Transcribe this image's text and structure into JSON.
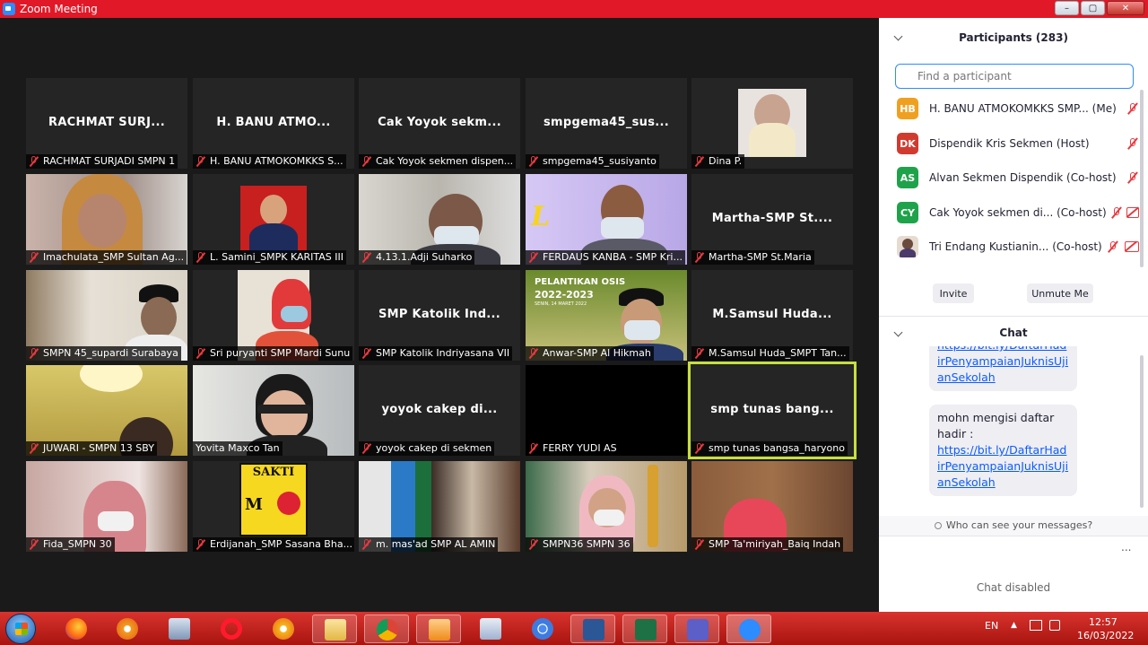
{
  "window": {
    "title": "Zoom Meeting",
    "controls": [
      "–",
      "▢",
      "✕"
    ]
  },
  "colors": {
    "title_bar": "#e11827",
    "taskbar": "#c4221d",
    "active_speaker_border": "#c7df3e",
    "muted_icon": "#e6393f",
    "link": "#0b5cff"
  },
  "tiles": [
    {
      "display": "RACHMAT  SURJ...",
      "label": "RACHMAT SURJADI SMPN 1"
    },
    {
      "display": "H. BANU  ATMO...",
      "label": "H. BANU ATMOKOMKKS S..."
    },
    {
      "display": "Cak  Yoyok  sekm...",
      "label": "Cak Yoyok sekmen dispen..."
    },
    {
      "display": "smpgema45_sus...",
      "label": "smpgema45_susiyanto"
    },
    {
      "display": "",
      "label": "Dina P."
    },
    {
      "display": "",
      "label": "Imachulata_SMP Sultan Ag..."
    },
    {
      "display": "",
      "label": "L. Samini_SMPK KARITAS III"
    },
    {
      "display": "",
      "label": "4.13.1.Adji Suharko"
    },
    {
      "display": "",
      "label": "FERDAUS KANBA - SMP Kri..."
    },
    {
      "display": "Martha-SMP  St....",
      "label": "Martha-SMP St.Maria"
    },
    {
      "display": "",
      "label": "SMPN 45_supardi Surabaya"
    },
    {
      "display": "",
      "label": "Sri puryanti SMP Mardi Sunu"
    },
    {
      "display": "SMP  Katolik  Ind...",
      "label": "SMP Katolik Indriyasana VII"
    },
    {
      "display": "",
      "label": "Anwar-SMP Al Hikmah",
      "poster_title": "PELANTIKAN OSIS",
      "poster_year": "2022-2023",
      "poster_date": "SENIN, 14 MARET 2022"
    },
    {
      "display": "M.Samsul  Huda...",
      "label": "M.Samsul Huda_SMPT Tan..."
    },
    {
      "display": "",
      "label": "JUWARI - SMPN 13 SBY"
    },
    {
      "display": "",
      "label": "Yovita Maxco Tan"
    },
    {
      "display": "yoyok  cakep  di...",
      "label": "yoyok cakep di sekmen"
    },
    {
      "display": "",
      "label": "FERRY YUDI AS"
    },
    {
      "display": "smp  tunas  bang...",
      "label": "smp tunas bangsa_haryono",
      "active": true
    },
    {
      "display": "",
      "label": "Fida_SMPN 30"
    },
    {
      "display": "",
      "label": "Erdijanah_SMP Sasana Bha...",
      "sign_top": "SAKTI",
      "sign_mid": "M"
    },
    {
      "display": "",
      "label": "m. mas'ad SMP AL AMIN"
    },
    {
      "display": "",
      "label": "SMPN36 SMPN 36"
    },
    {
      "display": "",
      "label": "SMP Ta'miriyah_Baiq Indah"
    }
  ],
  "participants": {
    "title": "Participants (283)",
    "search_placeholder": "Find a participant",
    "list": [
      {
        "initials": "HB",
        "color": "#f0a020",
        "name": "H. BANU ATMOKOMKKS SMP...",
        "role": "(Me)",
        "mic_muted": true,
        "cam_off": false
      },
      {
        "initials": "DK",
        "color": "#d13b2f",
        "name": "Dispendik Kris Sekmen",
        "role": "(Host)",
        "mic_muted": true,
        "cam_off": false
      },
      {
        "initials": "AS",
        "color": "#1fa34a",
        "name": "Alvan Sekmen Dispendik",
        "role": "(Co-host)",
        "mic_muted": true,
        "cam_off": false
      },
      {
        "initials": "CY",
        "color": "#1fa34a",
        "name": "Cak Yoyok sekmen di...",
        "role": "(Co-host)",
        "mic_muted": true,
        "cam_off": true
      },
      {
        "initials": "",
        "color": "#d9c9b8",
        "name": "Tri Endang Kustianin...",
        "role": "(Co-host)",
        "mic_muted": true,
        "cam_off": true
      }
    ],
    "invite_label": "Invite",
    "unmute_label": "Unmute Me"
  },
  "chat": {
    "title": "Chat",
    "partial_link": "https://bit.ly/DaftarHadirPenyampaianJuknisUjianSekolah",
    "message_text": "mohn mengisi daftar hadir :",
    "message_link": "https://bit.ly/DaftarHadirPenyampaianJuknisUjianSekolah",
    "who_can_see": "Who can see your messages?",
    "more": "...",
    "disabled": "Chat disabled"
  },
  "taskbar": {
    "lang": "EN",
    "time": "12:57",
    "date": "16/03/2022"
  }
}
